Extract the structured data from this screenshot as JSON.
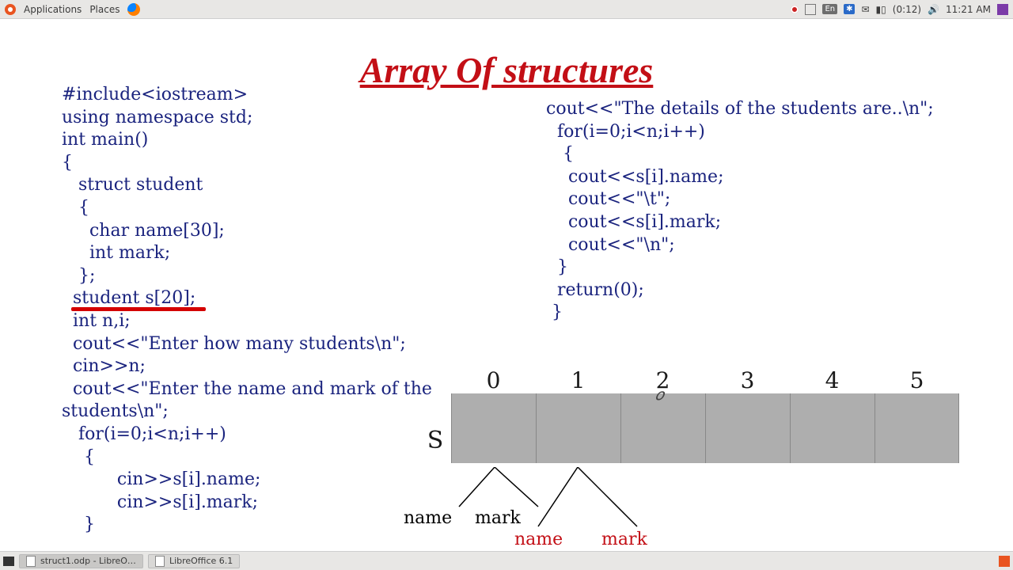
{
  "panel": {
    "apps": "Applications",
    "places": "Places",
    "lang": "En",
    "timer": "(0:12)",
    "clock": "11:21 AM"
  },
  "slide": {
    "title": "Array Of structures",
    "code_left": "#include<iostream>\nusing namespace std;\nint main()\n{\n   struct student\n   {\n     char name[30];\n     int mark;\n   };\n  student s[20];\n  int n,i;\n  cout<<\"Enter how many students\\n\";\n  cin>>n;\n  cout<<\"Enter the name and mark of the\nstudents\\n\";\n   for(i=0;i<n;i++)\n    {\n          cin>>s[i].name;\n          cin>>s[i].mark;\n    }",
    "code_right": "cout<<\"The details of the students are..\\n\";\n  for(i=0;i<n;i++)\n   {\n    cout<<s[i].name;\n    cout<<\"\\t\";\n    cout<<s[i].mark;\n    cout<<\"\\n\";\n  }\n  return(0);\n }",
    "array_label": "S",
    "indices": [
      "0",
      "1",
      "2",
      "3",
      "4",
      "5"
    ],
    "lbl_name_1": "name",
    "lbl_mark_1": "mark",
    "lbl_name_2": "name",
    "lbl_mark_2": "mark"
  },
  "taskbar": {
    "t1": "struct1.odp - LibreO…",
    "t2": "LibreOffice 6.1"
  }
}
